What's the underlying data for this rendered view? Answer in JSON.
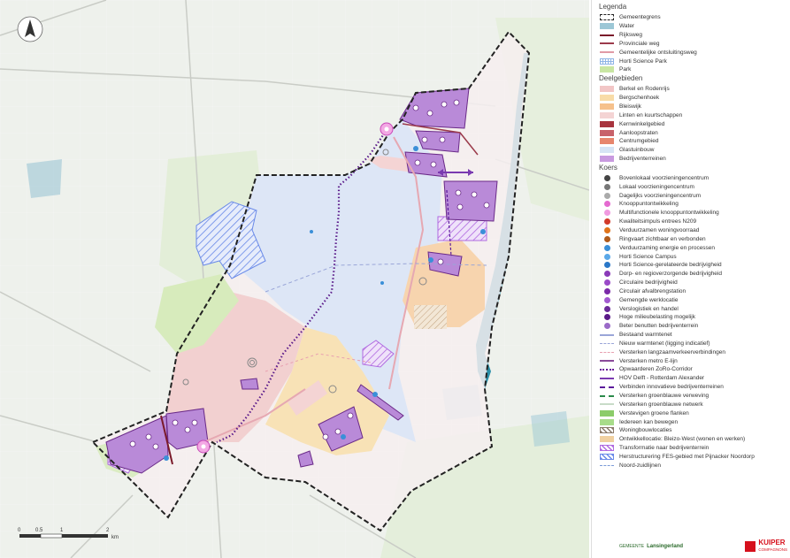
{
  "legend": {
    "title": "Legenda",
    "section1": [
      {
        "label": "Gemeentegrens",
        "symbol": "border",
        "color": "#222222"
      },
      {
        "label": "Water",
        "symbol": "fill",
        "color": "#9cc7d6"
      },
      {
        "label": "Rijksweg",
        "symbol": "line",
        "color": "#7a1a2a"
      },
      {
        "label": "Provinciale weg",
        "symbol": "line",
        "color": "#9b3b4b"
      },
      {
        "label": "Gemeentelijke ontsluitingsweg",
        "symbol": "line",
        "color": "#e09aa6"
      },
      {
        "label": "Horti Science Park",
        "symbol": "grid",
        "color": "#8fb5e6"
      },
      {
        "label": "Park",
        "symbol": "fill",
        "color": "#c9e6a3"
      }
    ],
    "deelgebieden_title": "Deelgebieden",
    "deelgebieden": [
      {
        "label": "Berkel en Rodenrijs",
        "color": "#f2c6c6"
      },
      {
        "label": "Bergschenhoek",
        "color": "#f8dca8"
      },
      {
        "label": "Bleiswijk",
        "color": "#f6c18c"
      },
      {
        "label": "Linten en kuurtschappen",
        "color": "#f4d4d4"
      },
      {
        "label": "Kernwinkelgebied",
        "color": "#a8343e"
      },
      {
        "label": "Aanloopstraten",
        "color": "#c8626a"
      },
      {
        "label": "Centrumgebied",
        "color": "#e7866d"
      },
      {
        "label": "Glastuinbouw",
        "color": "#d6e4f5"
      },
      {
        "label": "Bedrijventerreinen",
        "color": "#c99ae0"
      }
    ],
    "koers_title": "Koers",
    "koers": [
      {
        "label": "Bovenlokaal voorzieningencentrum",
        "symbol": "dot",
        "color": "#444444"
      },
      {
        "label": "Lokaal voorzieningencentrum",
        "symbol": "dot",
        "color": "#777777"
      },
      {
        "label": "Dagelijks voorzieningencentrum",
        "symbol": "dot",
        "color": "#aaaaaa"
      },
      {
        "label": "Knooppuntontwikkeling",
        "symbol": "dot",
        "color": "#e46ad0"
      },
      {
        "label": "Multifunctionele knooppuntontwikkeling",
        "symbol": "dot",
        "color": "#f09ae0"
      },
      {
        "label": "Kwaliteitsimpuls entrees N209",
        "symbol": "dot",
        "color": "#d23a2a"
      },
      {
        "label": "Verduurzamen woningvoorraad",
        "symbol": "dot",
        "color": "#e0731a"
      },
      {
        "label": "Ringvaart zichtbaar en verbonden",
        "symbol": "dot",
        "color": "#b05a1a"
      },
      {
        "label": "Verduurzaming energie en processen",
        "symbol": "dot",
        "color": "#3a8fd8"
      },
      {
        "label": "Horti Science Campus",
        "symbol": "dot",
        "color": "#5aa8e8"
      },
      {
        "label": "Horti Science-gerelateerde bedrijvigheid",
        "symbol": "dot",
        "color": "#2a78c8"
      },
      {
        "label": "Dorp- en regioverzorgende bedrijvigheid",
        "symbol": "dot",
        "color": "#8a3ab8"
      },
      {
        "label": "Circulaire bedrijvigheid",
        "symbol": "dot",
        "color": "#9a4ac8"
      },
      {
        "label": "Circulair afvalbrengstation",
        "symbol": "dot",
        "color": "#7a2aa8"
      },
      {
        "label": "Gemengde werklocatie",
        "symbol": "dot",
        "color": "#a25ad0"
      },
      {
        "label": "Verslogistiek en handel",
        "symbol": "dot",
        "color": "#6a2a98"
      },
      {
        "label": "Hoge milieubelasting mogelijk",
        "symbol": "dot",
        "color": "#5a1a88"
      },
      {
        "label": "Beter benutten bedrijventerrein",
        "symbol": "dot",
        "color": "#9a6ac8"
      },
      {
        "label": "Bestaand warmtenet",
        "symbol": "line",
        "color": "#9aa6d8"
      },
      {
        "label": "Nieuw warmtenet (ligging indicatief)",
        "symbol": "dash",
        "color": "#9aa6d8"
      },
      {
        "label": "Versterken langzaamverkeerverbindingen",
        "symbol": "dash",
        "color": "#e8a0b0"
      },
      {
        "label": "Versterken metro E-lijn",
        "symbol": "line",
        "color": "#8a4a9a"
      },
      {
        "label": "Opwaarderen ZoRo-Corridor",
        "symbol": "dots",
        "color": "#6a1a9a"
      },
      {
        "label": "HOV Delft - Rotterdam Alexander",
        "symbol": "arrow",
        "color": "#7a3ab0"
      },
      {
        "label": "Verbinden innovatieve bedrijventerreinen",
        "symbol": "arrowdash",
        "color": "#5a1a9a"
      },
      {
        "label": "Versterken groenblauwe verweving",
        "symbol": "arrowdash",
        "color": "#2a8a4a"
      },
      {
        "label": "Versterken groenblauwe netwerk",
        "symbol": "line",
        "color": "#c8dcc8"
      },
      {
        "label": "Verstevigen groene flanken",
        "symbol": "fill",
        "color": "#8ccc6a"
      },
      {
        "label": "Iedereen kan bewegen",
        "symbol": "fill",
        "color": "#a8dc8a"
      },
      {
        "label": "Woningbouwlocaties",
        "symbol": "hatch",
        "color": "#8a7a6a"
      },
      {
        "label": "Ontwikkellocatie: Bleizo-West (wonen en werken)",
        "symbol": "fill",
        "color": "#f0d0a0"
      },
      {
        "label": "Transformatie naar bedrijventerrein",
        "symbol": "hatch",
        "color": "#b06ae0"
      },
      {
        "label": "Herstructurering FES-gebied met Pijnacker Noordorp",
        "symbol": "hatch",
        "color": "#6a8ae8"
      },
      {
        "label": "Noord-zuidlijnen",
        "symbol": "dash",
        "color": "#7a9ad8"
      }
    ]
  },
  "scale": {
    "ticks": [
      "0",
      "0.5",
      "1",
      "2"
    ],
    "unit": "km"
  },
  "logos": {
    "left_tag": "GEMEENTE",
    "left_name": "Lansingerland",
    "right_name": "KUIPER",
    "right_sub": "COMPAGNONS"
  },
  "colors": {
    "base_map": "#eef0ec",
    "glastuinbouw": "#dfe6f5",
    "bedrijventerrein": "#b98ad8",
    "border": "#222222"
  }
}
